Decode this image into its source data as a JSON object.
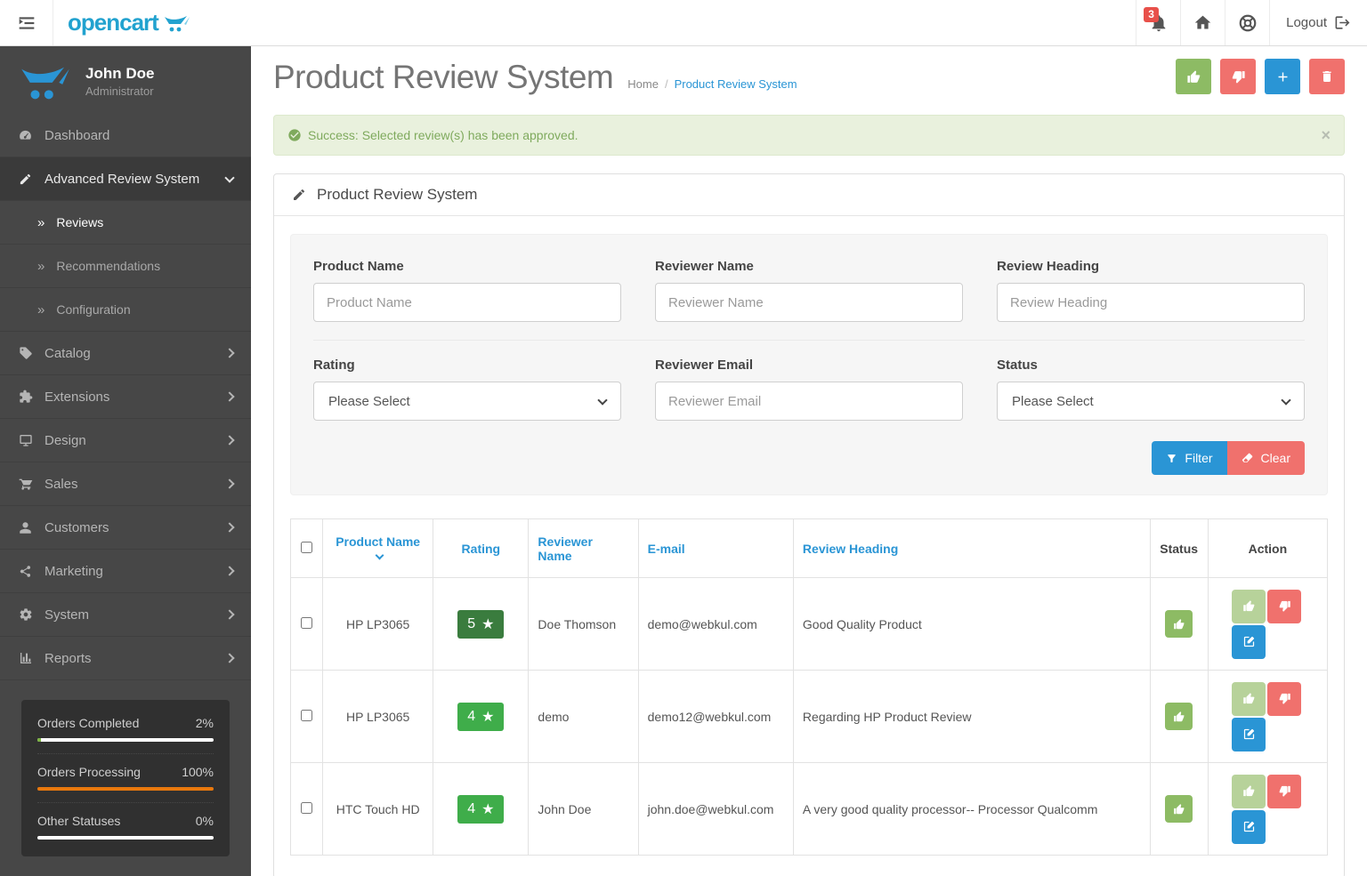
{
  "topbar": {
    "logo": "opencart",
    "notifications": {
      "count": "3"
    },
    "logout_label": "Logout"
  },
  "sidebar": {
    "user": {
      "name": "John Doe",
      "role": "Administrator"
    },
    "items": {
      "dashboard": "Dashboard",
      "advanced_review_system": "Advanced Review System",
      "reviews": "Reviews",
      "recommendations": "Recommendations",
      "configuration": "Configuration",
      "catalog": "Catalog",
      "extensions": "Extensions",
      "design": "Design",
      "sales": "Sales",
      "customers": "Customers",
      "marketing": "Marketing",
      "system": "System",
      "reports": "Reports"
    },
    "stats": [
      {
        "label": "Orders Completed",
        "value": "2%",
        "color": "#7cb342"
      },
      {
        "label": "Orders Processing",
        "value": "100%",
        "color": "#e8780d"
      },
      {
        "label": "Other Statuses",
        "value": "0%",
        "color": "#ffffff"
      }
    ]
  },
  "header": {
    "title": "Product Review System",
    "breadcrumb": {
      "home": "Home",
      "separator": "/",
      "current": "Product Review System"
    }
  },
  "alert": {
    "message": "Success: Selected review(s) has been approved.",
    "close": "×"
  },
  "panel": {
    "title": "Product Review System"
  },
  "filter": {
    "product_name": {
      "label": "Product Name",
      "placeholder": "Product Name"
    },
    "reviewer_name": {
      "label": "Reviewer Name",
      "placeholder": "Reviewer Name"
    },
    "review_heading": {
      "label": "Review Heading",
      "placeholder": "Review Heading"
    },
    "rating": {
      "label": "Rating",
      "value": "Please Select"
    },
    "reviewer_email": {
      "label": "Reviewer Email",
      "placeholder": "Reviewer Email"
    },
    "status": {
      "label": "Status",
      "value": "Please Select"
    },
    "filter_button": "Filter",
    "clear_button": "Clear"
  },
  "table": {
    "headers": {
      "product_name": "Product Name",
      "rating": "Rating",
      "reviewer_name": "Reviewer Name",
      "email": "E-mail",
      "review_heading": "Review Heading",
      "status": "Status",
      "action": "Action"
    },
    "rows": [
      {
        "product_name": "HP LP3065",
        "rating": "5",
        "rating_color": "#3a7c3e",
        "reviewer_name": "Doe Thomson",
        "email": "demo@webkul.com",
        "review_heading": "Good Quality Product"
      },
      {
        "product_name": "HP LP3065",
        "rating": "4",
        "rating_color": "#3fad4a",
        "reviewer_name": "demo",
        "email": "demo12@webkul.com",
        "review_heading": "Regarding HP Product Review"
      },
      {
        "product_name": "HTC Touch HD",
        "rating": "4",
        "rating_color": "#3fad4a",
        "reviewer_name": "John Doe",
        "email": "john.doe@webkul.com",
        "review_heading": "A very good quality processor-- Processor Qualcomm"
      }
    ]
  },
  "colors": {
    "accent_blue": "#2a95d5",
    "success_green": "#8dbb64",
    "danger_red": "#f0716d"
  }
}
